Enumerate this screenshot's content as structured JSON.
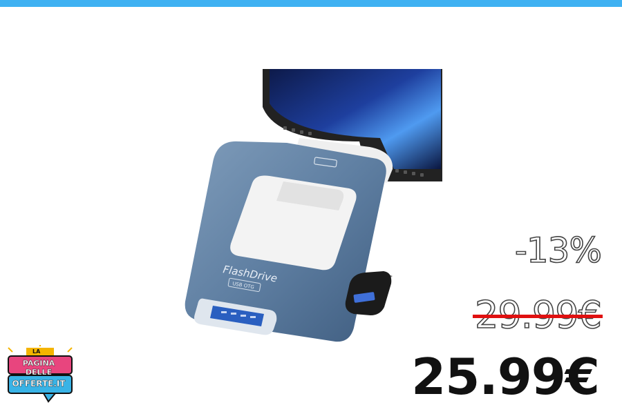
{
  "product": {
    "brand_text": "FlashDrive",
    "sub_label": "USB OTG"
  },
  "pricing": {
    "discount": "-13%",
    "old_price": "29.99€",
    "new_price": "25.99€"
  },
  "logo": {
    "line1": "LA",
    "line2": "PAGINA DELLE",
    "line3": "OFFERTE.IT"
  },
  "colors": {
    "top_bar": "#3fb1f2",
    "strike": "#e01010",
    "drive_body": "#5d7fa1"
  }
}
